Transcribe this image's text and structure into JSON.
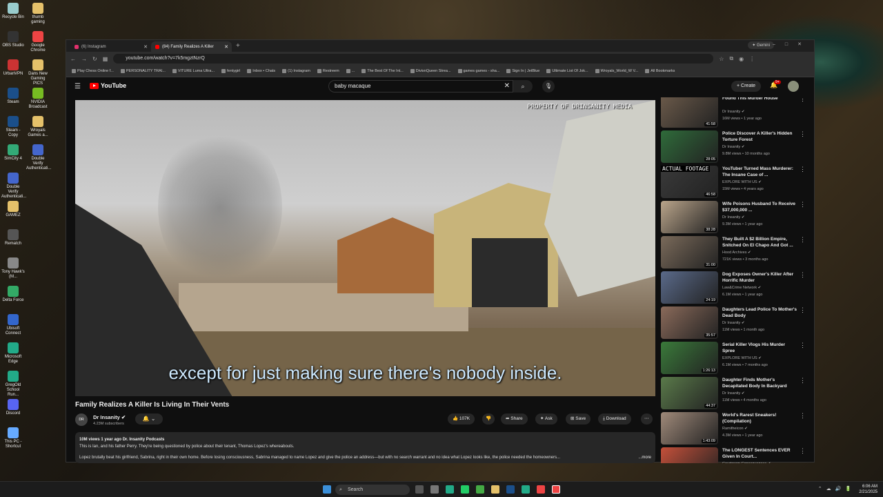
{
  "desktop_icons": [
    {
      "label": "Recycle Bin",
      "color": "#9cc"
    },
    {
      "label": "OBS Studio",
      "color": "#333"
    },
    {
      "label": "UrbanVPN",
      "color": "#c33"
    },
    {
      "label": "Steam",
      "color": "#1b4f8a"
    },
    {
      "label": "Steam - Copy",
      "color": "#1b4f8a"
    },
    {
      "label": "SimCity 4",
      "color": "#3a7"
    },
    {
      "label": "Double Verify Authenticati...",
      "color": "#46c"
    },
    {
      "label": "GAMEZ",
      "color": "#e5c16a"
    },
    {
      "label": "Rematch",
      "color": "#555"
    },
    {
      "label": "Tony Hawk's (M...",
      "color": "#888"
    },
    {
      "label": "Delta Force",
      "color": "#3a6"
    },
    {
      "label": "Ubisoft Connect",
      "color": "#36c"
    },
    {
      "label": "Microsoft Edge",
      "color": "#2a8"
    },
    {
      "label": "GregOld School Run...",
      "color": "#2a8"
    },
    {
      "label": "Discord",
      "color": "#5865f2"
    },
    {
      "label": "This PC - Shortcut",
      "color": "#6af"
    }
  ],
  "desktop_icons2": [
    {
      "label": "thumb gaming",
      "color": "#e5c16a"
    },
    {
      "label": "Google Chrome",
      "color": "#e44"
    },
    {
      "label": "Dans New Gaming PICS",
      "color": "#e5c16a"
    },
    {
      "label": "NVIDIA Broadcast",
      "color": "#7b2"
    },
    {
      "label": "Wroyals Games a...",
      "color": "#e5c16a"
    },
    {
      "label": "Double Verify Authenticati...",
      "color": "#46c"
    }
  ],
  "browser": {
    "tabs": [
      {
        "label": "(6) Instagram",
        "active": false
      },
      {
        "label": "(84) Family Realizes A Killer",
        "active": true
      }
    ],
    "gemini": "Gemini",
    "url": "youtube.com/watch?v=7k5mgztNzrQ",
    "bookmarks": [
      "Play Chess Online f...",
      "PERSONALITY TRAI...",
      "VITURE Luma Ultra...",
      "fentygirl",
      "Inbox • Chats",
      "(1) Instagram",
      "Restreem",
      "...",
      "The Best Of The Int...",
      "DivisnQueen Strea...",
      "games games - sha...",
      "Sign In | JetBlue",
      "Ultimate List Of Jok...",
      "Wroyals_World_W V...",
      "All Bookmarks"
    ]
  },
  "yt": {
    "logo": "YouTube",
    "search_value": "baby macaque",
    "create": "Create",
    "notif_count": "9+"
  },
  "video": {
    "watermark": "PROPERTY OF DRINSANITY MEDIA",
    "caption": "except for just making sure there's nobody inside.",
    "title": "Family Realizes A Killer Is Living In Their Vents",
    "channel": "Dr Insanity",
    "channel_avatar": "DR",
    "subscribers": "4.23M subscribers",
    "likes": "107K",
    "share": "Share",
    "ask": "Ask",
    "save": "Save",
    "download": "Download",
    "desc_meta": "10M views  1 year ago  Dr. Insanity Podcasts",
    "desc_line1": "This is Ian, and his father Perry. They're being questioned by police about their tenant, Thomas Lopez's whereabouts.",
    "desc_line2": "Lopez brutally beat his girlfriend, Sabrina, right in their own home. Before losing consciousness, Sabrina managed to name Lopez and give the police an address—but with no search warrant and no idea what Lopez looks like, the police needed the homeowners...",
    "more": "...more"
  },
  "recommendations": [
    {
      "title": "Found This Murder House",
      "channel": "Dr Insanity",
      "views": "16M views • 1 year ago",
      "dur": "41:58"
    },
    {
      "title": "Police Discover A Killer's Hidden Torture Forest",
      "channel": "Dr Insanity",
      "views": "9.8M views • 10 months ago",
      "dur": "28:05"
    },
    {
      "title": "YouTuber Turned Mass Murderer: The Insane Case of ...",
      "channel": "EXPLORE WITH US",
      "views": "15M views • 4 years ago",
      "dur": "46:58",
      "label": "ACTUAL FOOTAGE"
    },
    {
      "title": "Wife Poisons Husband To Receive $37,000,000 ...",
      "channel": "Dr Insanity",
      "views": "9.3M views • 1 year ago",
      "dur": "38:28"
    },
    {
      "title": "They Built A $2 Billion Empire, Snitched On El Chapo And Got ...",
      "channel": "Hood Archives",
      "views": "721K views • 3 months ago",
      "dur": "31:00"
    },
    {
      "title": "Dog Exposes Owner's Killer After Horrific Murder",
      "channel": "Law&Crime Network",
      "views": "6.1M views • 1 year ago",
      "dur": "24:19"
    },
    {
      "title": "Daughters Lead Police To Mother's Dead Body",
      "channel": "Dr Insanity",
      "views": "11M views • 1 month ago",
      "dur": "35:57"
    },
    {
      "title": "Serial Killer Vlogs His Murder Spree",
      "channel": "EXPLORE WITH US",
      "views": "6.1M views • 7 months ago",
      "dur": "1:26:13"
    },
    {
      "title": "Daughter Finds Mother's Decapitated Body In Backyard",
      "channel": "Dr Insanity",
      "views": "11M views • 4 months ago",
      "dur": "44:37"
    },
    {
      "title": "World's Rarest Sneakers! (Compilation)",
      "channel": "Ramitheicon",
      "views": "4.3M views • 1 year ago",
      "dur": "1:43:09"
    },
    {
      "title": "The LONGEST Sentences EVER Given In Court...",
      "channel": "Courtroom Consequences",
      "views": "",
      "dur": ""
    }
  ],
  "taskbar": {
    "search": "Search",
    "time": "6:06 AM",
    "date": "2/21/2025"
  }
}
